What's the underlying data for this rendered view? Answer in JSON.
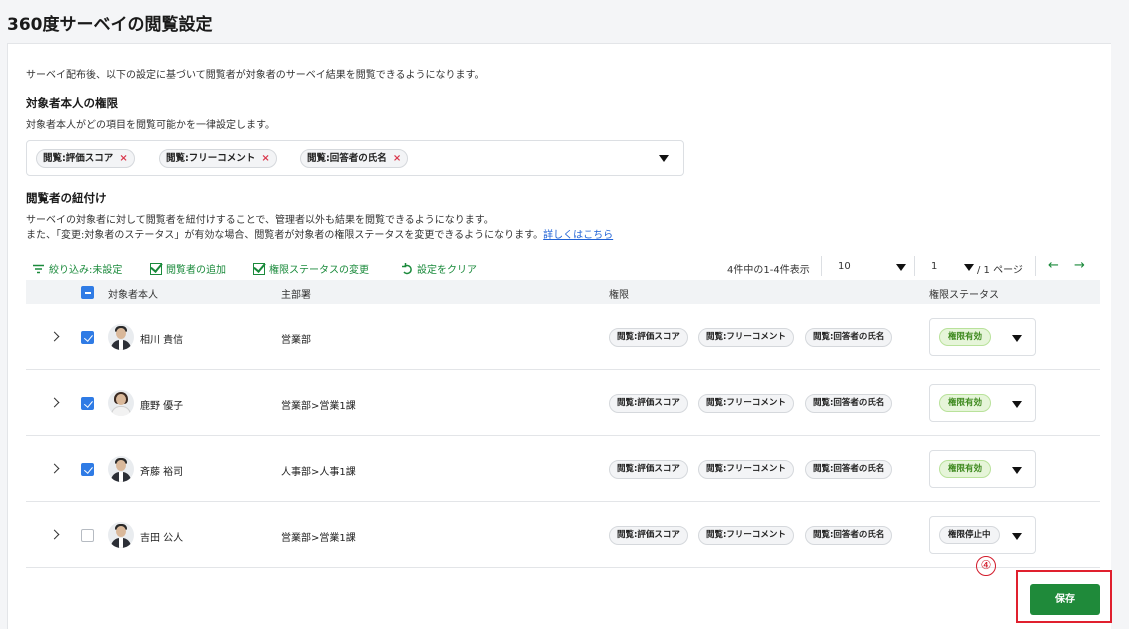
{
  "page_title": "360度サーベイの閲覧設定",
  "intro": "サーベイ配布後、以下の設定に基づいて閲覧者が対象者のサーベイ結果を閲覧できるようになります。",
  "self_permission": {
    "title": "対象者本人の権限",
    "description": "対象者本人がどの項目を閲覧可能かを一律設定します。",
    "selected": [
      "閲覧:評価スコア",
      "閲覧:フリーコメント",
      "閲覧:回答者の氏名"
    ],
    "remove_mark": "×"
  },
  "viewer_link": {
    "title": "閲覧者の紐付け",
    "desc_line1": "サーベイの対象者に対して閲覧者を紐付けすることで、管理者以外も結果を閲覧できるようになります。",
    "desc_line2": "また、「変更:対象者のステータス」が有効な場合、閲覧者が対象者の権限ステータスを変更できるようになります。",
    "more_link": "詳しくはこちら"
  },
  "toolbar": {
    "filter_label": "絞り込み:未設定",
    "add_viewer_label": "閲覧者の追加",
    "change_status_label": "権限ステータスの変更",
    "clear_label": "設定をクリア"
  },
  "pagination": {
    "summary": "4件中の1-4件表示",
    "per_page": "10",
    "page": "1",
    "page_total": "/ 1 ページ",
    "prev_arrow": "←",
    "next_arrow": "→"
  },
  "table": {
    "columns": [
      "対象者本人",
      "主部署",
      "権限",
      "権限ステータス"
    ],
    "rows": [
      {
        "name": "相川 貴信",
        "dept": "営業部",
        "perms": [
          "閲覧:評価スコア",
          "閲覧:フリーコメント",
          "閲覧:回答者の氏名"
        ],
        "status": "権限有効",
        "checked": true
      },
      {
        "name": "鹿野 優子",
        "dept": "営業部>営業1課",
        "perms": [
          "閲覧:評価スコア",
          "閲覧:フリーコメント",
          "閲覧:回答者の氏名"
        ],
        "status": "権限有効",
        "checked": true
      },
      {
        "name": "斉藤 裕司",
        "dept": "人事部>人事1課",
        "perms": [
          "閲覧:評価スコア",
          "閲覧:フリーコメント",
          "閲覧:回答者の氏名"
        ],
        "status": "権限有効",
        "checked": true
      },
      {
        "name": "吉田 公人",
        "dept": "営業部>営業1課",
        "perms": [
          "閲覧:評価スコア",
          "閲覧:フリーコメント",
          "閲覧:回答者の氏名"
        ],
        "status": "権限停止中",
        "checked": false
      }
    ]
  },
  "annotation_number": "④",
  "save_label": "保存",
  "colors": {
    "accent_green": "#1f8a3a",
    "checkbox_blue": "#2f7be5",
    "annotation_red": "#e0202e"
  }
}
